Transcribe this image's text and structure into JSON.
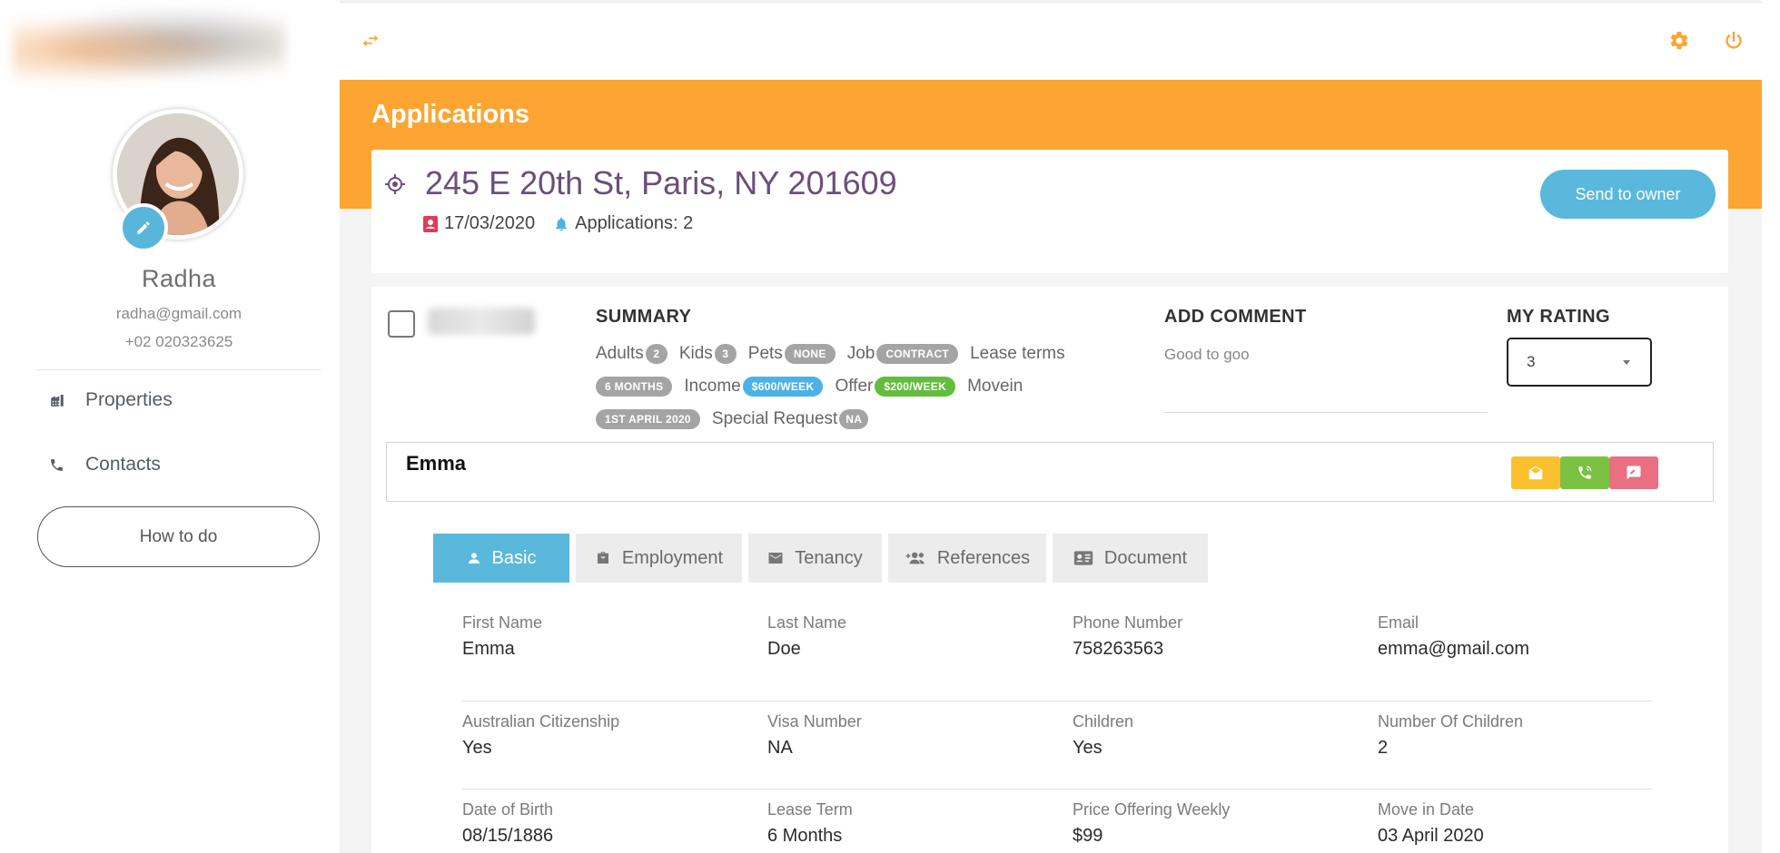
{
  "sidebar": {
    "user": {
      "name": "Radha",
      "email": "radha@gmail.com",
      "phone": "+02 020323625"
    },
    "nav": [
      {
        "label": "Properties",
        "icon": "building-icon"
      },
      {
        "label": "Contacts",
        "icon": "phone-icon"
      }
    ],
    "howto_label": "How to do"
  },
  "topbar": {
    "icons": [
      "swap-icon",
      "gear-icon",
      "power-icon"
    ]
  },
  "page": {
    "title": "Applications"
  },
  "property": {
    "address": "245 E 20th St, Paris, NY 201609",
    "date": "17/03/2020",
    "applications_text": "Applications: 2",
    "send_label": "Send to owner"
  },
  "summary": {
    "title": "SUMMARY",
    "adults_label": "Adults",
    "adults": "2",
    "kids_label": "Kids",
    "kids": "3",
    "pets_label": "Pets",
    "pets": "NONE",
    "job_label": "Job",
    "job": "CONTRACT",
    "lease_label": "Lease terms",
    "lease": "6 MONTHS",
    "income_label": "Income",
    "income": "$600/WEEK",
    "offer_label": "Offer",
    "offer": "$200/WEEK",
    "movein_label": "Movein",
    "movein": "1ST APRIL 2020",
    "special_label": "Special Request",
    "special": "NA"
  },
  "comment": {
    "title": "ADD COMMENT",
    "value": "Good to goo"
  },
  "rating": {
    "title": "MY RATING",
    "value": "3"
  },
  "applicant": {
    "name": "Emma"
  },
  "colors": {
    "orange": "#fca533",
    "blue": "#5ab8dc",
    "yellow": "#fbc02d",
    "green": "#7cc242",
    "red": "#ea6f83",
    "address": "#6b4f7a"
  },
  "tabs": [
    {
      "label": "Basic",
      "icon": "person-icon",
      "active": true
    },
    {
      "label": "Employment",
      "icon": "briefcase-icon",
      "active": false
    },
    {
      "label": "Tenancy",
      "icon": "envelope-icon",
      "active": false
    },
    {
      "label": "References",
      "icon": "people-add-icon",
      "active": false
    },
    {
      "label": "Document",
      "icon": "id-card-icon",
      "active": false
    }
  ],
  "basic_info": [
    [
      {
        "label": "First Name",
        "value": "Emma"
      },
      {
        "label": "Last Name",
        "value": "Doe"
      },
      {
        "label": "Phone Number",
        "value": "758263563"
      },
      {
        "label": "Email",
        "value": "emma@gmail.com"
      }
    ],
    [
      {
        "label": "Australian Citizenship",
        "value": "Yes"
      },
      {
        "label": "Visa Number",
        "value": "NA"
      },
      {
        "label": "Children",
        "value": "Yes"
      },
      {
        "label": "Number Of Children",
        "value": "2"
      }
    ],
    [
      {
        "label": "Date of Birth",
        "value": "08/15/1886"
      },
      {
        "label": "Lease Term",
        "value": "6 Months"
      },
      {
        "label": "Price Offering Weekly",
        "value": "$99"
      },
      {
        "label": "Move in Date",
        "value": "03 April 2020"
      }
    ]
  ]
}
